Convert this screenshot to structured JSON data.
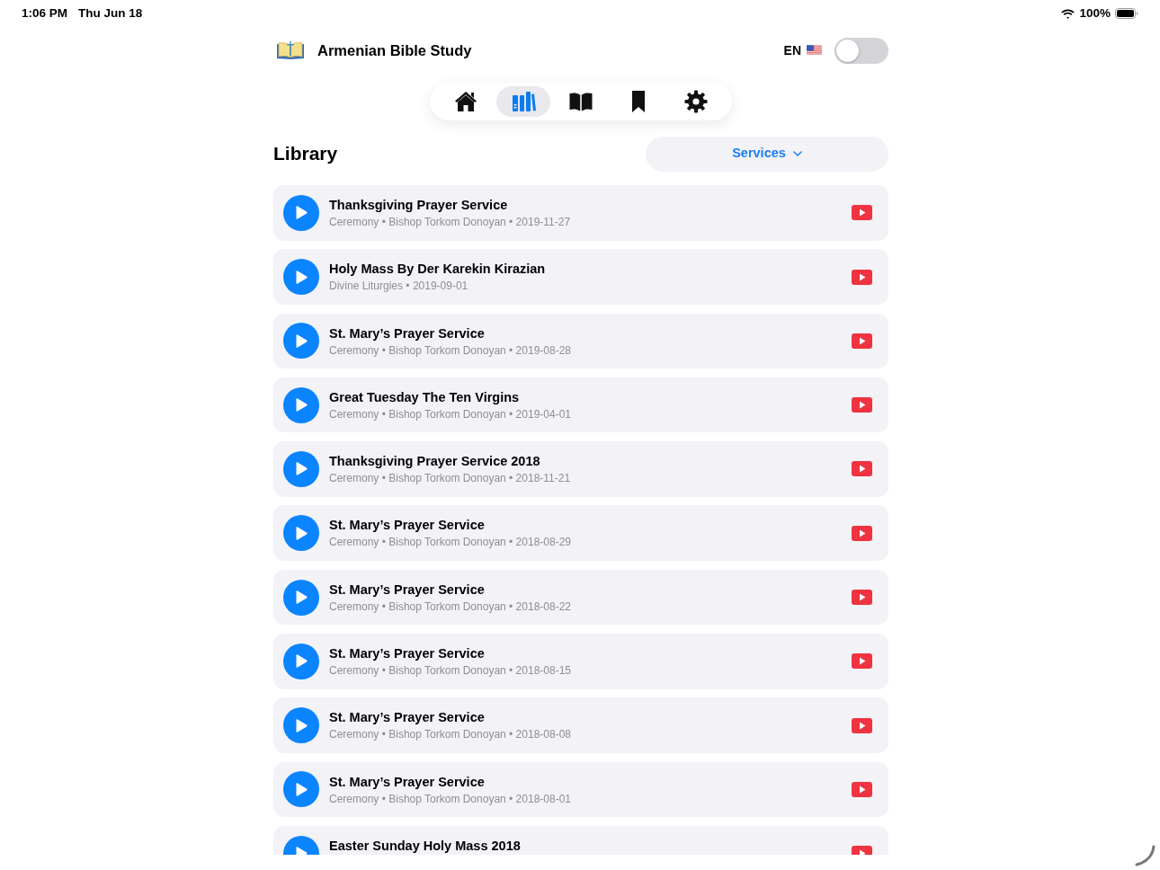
{
  "status_bar": {
    "time": "1:06 PM",
    "date": "Thu Jun 18",
    "battery": "100%"
  },
  "header": {
    "title": "Armenian Bible Study",
    "language": "EN",
    "language_toggle": {
      "on": false
    }
  },
  "tabs": [
    {
      "kind": "home",
      "selected": false
    },
    {
      "kind": "library",
      "selected": true
    },
    {
      "kind": "reader",
      "selected": false
    },
    {
      "kind": "bookmarks",
      "selected": false
    },
    {
      "kind": "settings",
      "selected": false
    }
  ],
  "library": {
    "title": "Library",
    "filter": "Services",
    "items": [
      {
        "title": "Thanksgiving Prayer Service",
        "subtitle": "Ceremony • Bishop Torkom Donoyan • 2019-11-27"
      },
      {
        "title": "Holy Mass By Der Karekin Kirazian",
        "subtitle": "Divine Liturgies • 2019-09-01"
      },
      {
        "title": "St. Mary’s Prayer Service",
        "subtitle": "Ceremony • Bishop Torkom Donoyan • 2019-08-28"
      },
      {
        "title": "Great Tuesday The Ten Virgins",
        "subtitle": "Ceremony • Bishop Torkom Donoyan • 2019-04-01"
      },
      {
        "title": "Thanksgiving Prayer Service 2018",
        "subtitle": "Ceremony • Bishop Torkom Donoyan • 2018-11-21"
      },
      {
        "title": "St. Mary’s Prayer Service",
        "subtitle": "Ceremony • Bishop Torkom Donoyan • 2018-08-29"
      },
      {
        "title": "St. Mary’s Prayer Service",
        "subtitle": "Ceremony • Bishop Torkom Donoyan • 2018-08-22"
      },
      {
        "title": "St. Mary’s Prayer Service",
        "subtitle": "Ceremony • Bishop Torkom Donoyan • 2018-08-15"
      },
      {
        "title": "St. Mary’s Prayer Service",
        "subtitle": "Ceremony • Bishop Torkom Donoyan • 2018-08-08"
      },
      {
        "title": "St. Mary’s Prayer Service",
        "subtitle": "Ceremony • Bishop Torkom Donoyan • 2018-08-01"
      },
      {
        "title": "Easter Sunday Holy Mass 2018"
      }
    ]
  }
}
